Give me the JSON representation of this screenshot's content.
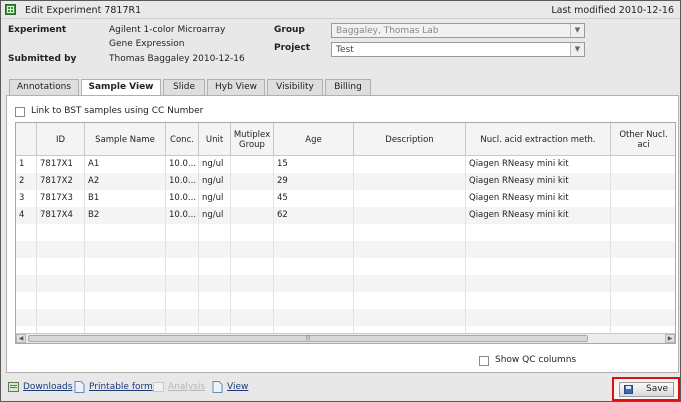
{
  "window": {
    "title": "Edit Experiment 7817R1",
    "last_modified": "Last modified  2010-12-16"
  },
  "header": {
    "experiment_label": "Experiment",
    "experiment_line1": "Agilent 1-color Microarray",
    "experiment_line2": "Gene Expression",
    "submitted_label": "Submitted by",
    "submitted_value": "Thomas Baggaley  2010-12-16",
    "group_label": "Group",
    "group_value": "Baggaley, Thomas Lab",
    "project_label": "Project",
    "project_value": "Test"
  },
  "tabs": [
    {
      "label": "Annotations",
      "active": false
    },
    {
      "label": "Sample View",
      "active": true
    },
    {
      "label": "Slide",
      "active": false
    },
    {
      "label": "Hyb View",
      "active": false
    },
    {
      "label": "Visibility",
      "active": false
    },
    {
      "label": "Billing",
      "active": false
    }
  ],
  "panel": {
    "link_bst_label": "Link to BST samples using CC Number",
    "show_qc_label": "Show QC columns"
  },
  "grid": {
    "columns": [
      "",
      "ID",
      "Sample Name",
      "Conc.",
      "Unit",
      "Mutiplex Group",
      "Age",
      "Description",
      "Nucl. acid extraction meth.",
      "Other Nucl. aci"
    ],
    "rows": [
      [
        "1",
        "7817X1",
        "A1",
        "10.0...",
        "ng/ul",
        "",
        "15",
        "",
        "Qiagen RNeasy mini kit",
        ""
      ],
      [
        "2",
        "7817X2",
        "A2",
        "10.0...",
        "ng/ul",
        "",
        "29",
        "",
        "Qiagen RNeasy mini kit",
        ""
      ],
      [
        "3",
        "7817X3",
        "B1",
        "10.0...",
        "ng/ul",
        "",
        "45",
        "",
        "Qiagen RNeasy mini kit",
        ""
      ],
      [
        "4",
        "7817X4",
        "B2",
        "10.0...",
        "ng/ul",
        "",
        "62",
        "",
        "Qiagen RNeasy mini kit",
        ""
      ]
    ]
  },
  "footer": {
    "downloads": "Downloads",
    "printable_form": "Printable form",
    "analysis": "Analysis",
    "view": "View",
    "save": "Save"
  },
  "colors": {
    "highlight": "#e01010",
    "link": "#1a3a7a"
  }
}
